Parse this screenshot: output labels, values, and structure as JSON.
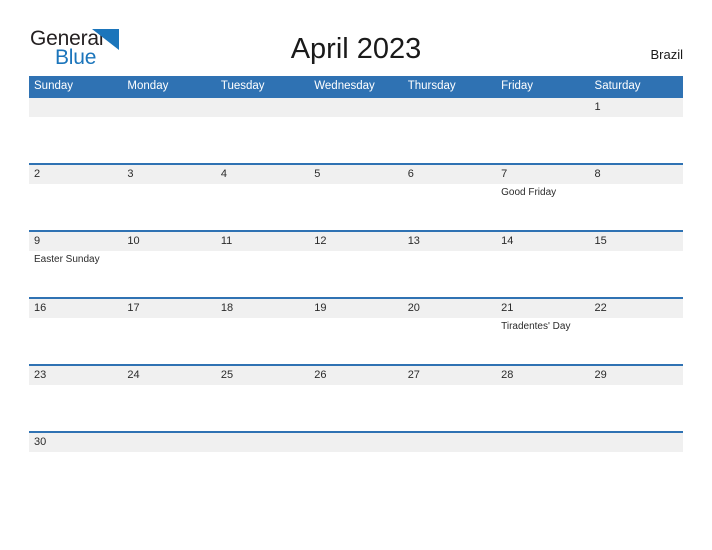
{
  "logo": {
    "line1": "General",
    "line2": "Blue",
    "triangle_icon": "triangle-icon",
    "color_text": "#231f20",
    "color_blue": "#1b75bb"
  },
  "header": {
    "title": "April 2023",
    "country": "Brazil"
  },
  "colors": {
    "header_blue": "#2f72b3",
    "row_band_gray": "#f0f0f0",
    "text": "#2b2b2b",
    "white": "#ffffff"
  },
  "calendar": {
    "weekdays": [
      "Sunday",
      "Monday",
      "Tuesday",
      "Wednesday",
      "Thursday",
      "Friday",
      "Saturday"
    ],
    "weeks": [
      {
        "days": [
          {
            "number": "",
            "event": ""
          },
          {
            "number": "",
            "event": ""
          },
          {
            "number": "",
            "event": ""
          },
          {
            "number": "",
            "event": ""
          },
          {
            "number": "",
            "event": ""
          },
          {
            "number": "",
            "event": ""
          },
          {
            "number": "1",
            "event": ""
          }
        ]
      },
      {
        "days": [
          {
            "number": "2",
            "event": ""
          },
          {
            "number": "3",
            "event": ""
          },
          {
            "number": "4",
            "event": ""
          },
          {
            "number": "5",
            "event": ""
          },
          {
            "number": "6",
            "event": ""
          },
          {
            "number": "7",
            "event": "Good Friday"
          },
          {
            "number": "8",
            "event": ""
          }
        ]
      },
      {
        "days": [
          {
            "number": "9",
            "event": "Easter Sunday"
          },
          {
            "number": "10",
            "event": ""
          },
          {
            "number": "11",
            "event": ""
          },
          {
            "number": "12",
            "event": ""
          },
          {
            "number": "13",
            "event": ""
          },
          {
            "number": "14",
            "event": ""
          },
          {
            "number": "15",
            "event": ""
          }
        ]
      },
      {
        "days": [
          {
            "number": "16",
            "event": ""
          },
          {
            "number": "17",
            "event": ""
          },
          {
            "number": "18",
            "event": ""
          },
          {
            "number": "19",
            "event": ""
          },
          {
            "number": "20",
            "event": ""
          },
          {
            "number": "21",
            "event": "Tiradentes' Day"
          },
          {
            "number": "22",
            "event": ""
          }
        ]
      },
      {
        "days": [
          {
            "number": "23",
            "event": ""
          },
          {
            "number": "24",
            "event": ""
          },
          {
            "number": "25",
            "event": ""
          },
          {
            "number": "26",
            "event": ""
          },
          {
            "number": "27",
            "event": ""
          },
          {
            "number": "28",
            "event": ""
          },
          {
            "number": "29",
            "event": ""
          }
        ]
      },
      {
        "days": [
          {
            "number": "30",
            "event": ""
          },
          {
            "number": "",
            "event": ""
          },
          {
            "number": "",
            "event": ""
          },
          {
            "number": "",
            "event": ""
          },
          {
            "number": "",
            "event": ""
          },
          {
            "number": "",
            "event": ""
          },
          {
            "number": "",
            "event": ""
          }
        ]
      }
    ]
  }
}
